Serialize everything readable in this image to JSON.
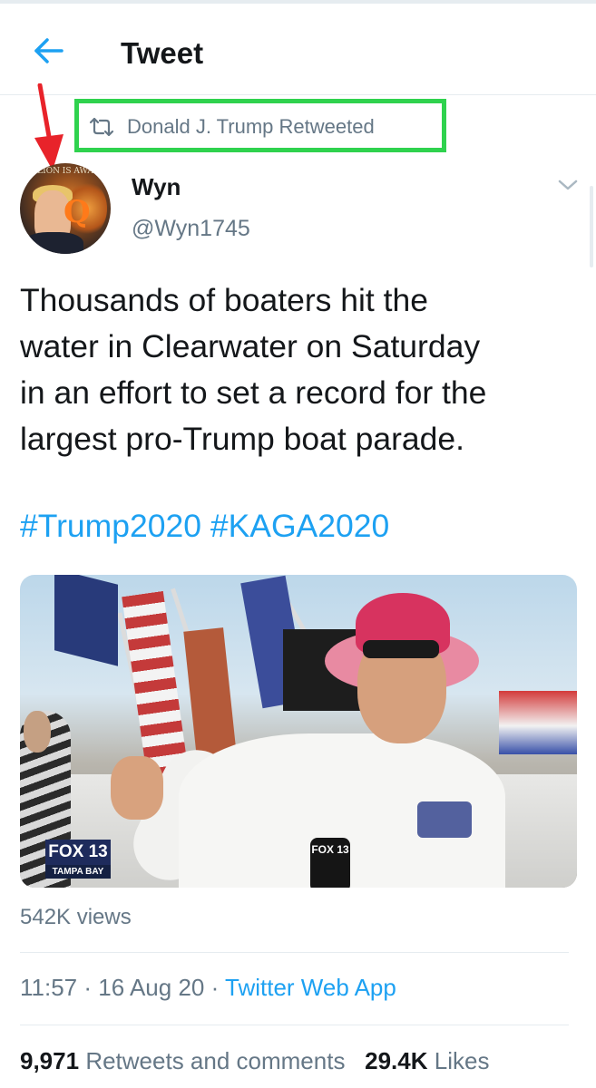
{
  "header": {
    "title": "Tweet",
    "back_icon": "arrow-left-icon"
  },
  "retweet": {
    "icon": "retweet-icon",
    "text": "Donald J. Trump Retweeted"
  },
  "author": {
    "name": "Wyn",
    "handle": "@Wyn1745",
    "avatar_text": "LION IS AWA"
  },
  "tweet": {
    "lines": [
      "Thousands of boaters hit the",
      "water in Clearwater on Saturday",
      "in an effort to set a record for the",
      "largest pro-Trump boat parade."
    ],
    "hashtags": [
      "#Trump2020",
      "#KAGA2020"
    ]
  },
  "media": {
    "type": "video",
    "station_badge_top": "FOX 13",
    "station_badge_bottom": "TAMPA BAY",
    "mic_label": "FOX 13"
  },
  "views": "542K views",
  "meta": {
    "time": "11:57",
    "separator": " · ",
    "date": "16 Aug 20",
    "source": "Twitter Web App"
  },
  "stats": {
    "retweets_count": "9,971",
    "retweets_label": "Retweets and comments",
    "likes_count": "29.4K",
    "likes_label": "Likes"
  },
  "colors": {
    "accent": "#1da1f2",
    "secondary_text": "#657786",
    "highlight_box": "#2fd24e",
    "annotation_arrow": "#e8232a"
  }
}
